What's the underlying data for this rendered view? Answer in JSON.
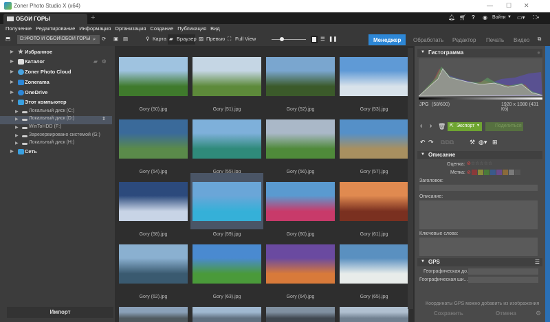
{
  "window": {
    "title": "Zoner Photo Studio X (x64)",
    "minimize": "—",
    "maximize": "☐",
    "close": "✕"
  },
  "tab": {
    "label": "ОБОИ ГОРЫ",
    "new_tab": "+"
  },
  "topright": {
    "login": "Войти"
  },
  "menu": [
    "Получение",
    "Редактирование",
    "Информация",
    "Организация",
    "Создание",
    "Публикация",
    "Вид"
  ],
  "toolbar": {
    "path": "D:\\ФОТО И ОБОИ\\ОБОИ ГОРЫ",
    "map": "Карта",
    "browser": "Браузер",
    "preview": "Превью",
    "fullview": "Full View",
    "zoom_slider": 0.3
  },
  "modes": [
    "Менеджер",
    "Обработать",
    "Редактор",
    "Печать",
    "Видео"
  ],
  "sidebar": {
    "items": [
      {
        "label": "Избранное",
        "icon": "star-icon",
        "color": "#ccc"
      },
      {
        "label": "Каталог",
        "icon": "catalog-icon",
        "color": "#ddd"
      },
      {
        "label": "Zoner Photo Cloud",
        "icon": "cloud-icon",
        "color": "#4aa3df"
      },
      {
        "label": "Zonerama",
        "icon": "zonerama-icon",
        "color": "#2d87d6"
      },
      {
        "label": "OneDrive",
        "icon": "onedrive-icon",
        "color": "#2d87d6"
      },
      {
        "label": "Этот компьютер",
        "icon": "computer-icon",
        "color": "#3aa0e0"
      }
    ],
    "drives": [
      "Локальный диск (C:)",
      "Локальный диск (D:)",
      "WinToHDD (F:)",
      "Зарезервировано системой (G:)",
      "Локальный диск (H:)"
    ],
    "network": "Сеть",
    "import": "Импорт"
  },
  "photos": [
    {
      "name": "Gory (50).jpg",
      "c": [
        "#9fc3e0",
        "#3f7a2c"
      ]
    },
    {
      "name": "Gory (51).jpg",
      "c": [
        "#c5d6e4",
        "#5d8a3a"
      ]
    },
    {
      "name": "Gory (52).jpg",
      "c": [
        "#7aa6cf",
        "#3b5a2a"
      ]
    },
    {
      "name": "Gory (53).jpg",
      "c": [
        "#5f9ad6",
        "#d8e2ea"
      ]
    },
    {
      "name": "Gory (54).jpg",
      "c": [
        "#3a6a9a",
        "#5a8a4a"
      ]
    },
    {
      "name": "Gory (55).jpg",
      "c": [
        "#7eb0da",
        "#2f8a7a"
      ]
    },
    {
      "name": "Gory (56).jpg",
      "c": [
        "#aab8c8",
        "#4f8a3a"
      ]
    },
    {
      "name": "Gory (57).jpg",
      "c": [
        "#5590c8",
        "#a89060"
      ]
    },
    {
      "name": "Gory (58).jpg",
      "c": [
        "#2c4a7c",
        "#c8d4e6"
      ]
    },
    {
      "name": "Gory (59).jpg",
      "c": [
        "#6aa6d8",
        "#35b0d8"
      ]
    },
    {
      "name": "Gory (60).jpg",
      "c": [
        "#5a9ad0",
        "#c83a6a"
      ]
    },
    {
      "name": "Gory (61).jpg",
      "c": [
        "#e08a50",
        "#7a3020"
      ]
    },
    {
      "name": "Gory (62).jpg",
      "c": [
        "#8ab0d0",
        "#3a5a70"
      ]
    },
    {
      "name": "Gory (63).jpg",
      "c": [
        "#4a8ad0",
        "#4a9a3a"
      ]
    },
    {
      "name": "Gory (64).jpg",
      "c": [
        "#6a4aa0",
        "#d87a3a"
      ]
    },
    {
      "name": "Gory (65).jpg",
      "c": [
        "#5a90c0",
        "#e8ecea"
      ]
    },
    {
      "name": "",
      "c": [
        "#8aa0b8",
        "#505a60"
      ]
    },
    {
      "name": "",
      "c": [
        "#a0b8d0",
        "#607080"
      ]
    },
    {
      "name": "",
      "c": [
        "#8090a0",
        "#404850"
      ]
    },
    {
      "name": "",
      "c": [
        "#b0c0d0",
        "#708090"
      ]
    }
  ],
  "selected_index": 9,
  "right": {
    "histogram": {
      "title": "Гистограмма",
      "format": "JPG",
      "position": "(58/600)",
      "info": "1920 x 1080 (431 Кб)"
    },
    "export": "Экспорт",
    "share": "Поделиться",
    "description": {
      "title": "Описание",
      "rating": "Оценка:",
      "label": "Метка:",
      "heading": "Заголовок:",
      "desc": "Описание:",
      "keywords": "Ключевые слова:",
      "label_colors": [
        "#8a3a3a",
        "#8a8a3a",
        "#4a7a3a",
        "#3a5a8a",
        "#6a4a8a",
        "#8a6a3a",
        "#7a7a7a",
        "#555"
      ]
    },
    "gps": {
      "title": "GPS",
      "lon": "Географическая до...",
      "lat": "Географическая ши...",
      "hint": "Координаты GPS можно добавить из изображения"
    },
    "save": "Сохранить",
    "cancel": "Отмена"
  }
}
